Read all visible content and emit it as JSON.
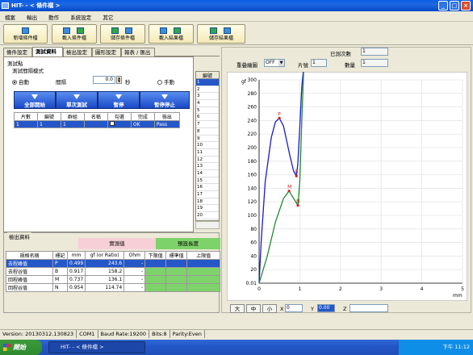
{
  "window": {
    "title": "HIT- - < 條件檔 >",
    "min": "_",
    "max": "□",
    "close": "×"
  },
  "menu": [
    "檔案",
    "輸出",
    "動作",
    "系統設定",
    "其它"
  ],
  "toolbar": [
    {
      "label": "新增條件檔"
    },
    {
      "label": "載入條件檔"
    },
    {
      "label": "儲存條件檔"
    },
    {
      "label": "載入結果檔"
    },
    {
      "label": "儲存結果檔"
    }
  ],
  "tabs": [
    "條件設定",
    "測試資料",
    "檢出設定",
    "圖形設定",
    "報表 / 匯出"
  ],
  "test": {
    "group_title": "測試點",
    "mode_title": "測試間隔模式",
    "auto": "自動",
    "interval": "間隔",
    "interval_value": "0.0",
    "unit": "秒",
    "manual": "手動"
  },
  "buttons": {
    "start": "全部開始",
    "single": "單次測試",
    "pause": "暫停",
    "stop": "暫停停止"
  },
  "table": {
    "headers": [
      "片數",
      "編號",
      "群組",
      "名稱",
      "勾選",
      "完成",
      "檢出"
    ],
    "rows": [
      [
        "1",
        "1",
        "1",
        "",
        "",
        "OK",
        "Pass"
      ]
    ]
  },
  "index_col": {
    "header": "編號",
    "items": [
      "1",
      "2",
      "3",
      "4",
      "5",
      "6",
      "7",
      "8",
      "9",
      "10",
      "11",
      "12",
      "13",
      "14",
      "15",
      "16",
      "17",
      "18",
      "19",
      "20"
    ]
  },
  "detect": {
    "title": "檢出資料",
    "measured": "實測值",
    "preset": "預設長度",
    "headers": [
      "規格名稱",
      "標記",
      "mm",
      "gf (or Ratio)",
      "Ohm",
      "下限值",
      "標準值",
      "上限值"
    ],
    "rows": [
      [
        "去程峰值",
        "P",
        "0.499",
        "243.6",
        "-"
      ],
      [
        "去程谷值",
        "B",
        "0.917",
        "158.2",
        "-"
      ],
      [
        "回程峰值",
        "M",
        "0.737",
        "136.1",
        "-"
      ],
      [
        "回程谷值",
        "N",
        "0.954",
        "114.74",
        "-"
      ]
    ]
  },
  "graph": {
    "done_label": "已測次數",
    "done_value": "1",
    "overlay_label": "重疊繪圖",
    "overlay_value": "OFF",
    "piece_label": "片號",
    "piece_value": "1",
    "count_label": "數量",
    "count_value": "1",
    "zoom": [
      "大",
      "中",
      "小"
    ],
    "x_label": "X",
    "x_value": "0",
    "y_label": "Y",
    "y_value": "0.00",
    "z_label": "Z",
    "z_value": ""
  },
  "chart_data": {
    "type": "line",
    "ylabel": "gf",
    "xlabel": "mm",
    "xlim": [
      0,
      5
    ],
    "ylim": [
      0,
      300
    ],
    "xticks": [
      "0",
      "1",
      "2",
      "3",
      "4",
      "5"
    ],
    "yticks": [
      "0.01",
      "20",
      "40",
      "60",
      "80",
      "100",
      "120",
      "140",
      "160",
      "180",
      "200",
      "220",
      "240",
      "260",
      "280",
      "300"
    ],
    "series": [
      {
        "color": "#1a1ad0",
        "x": [
          0,
          0.05,
          0.15,
          0.3,
          0.4,
          0.499,
          0.6,
          0.75,
          0.85,
          0.917,
          0.95,
          1.0,
          1.05,
          1.1
        ],
        "y": [
          0,
          60,
          150,
          215,
          238,
          243.6,
          232,
          190,
          165,
          158.2,
          175,
          230,
          290,
          320
        ]
      },
      {
        "color": "#208a30",
        "x": [
          0,
          0.2,
          0.4,
          0.6,
          0.737,
          0.85,
          0.954,
          1.0,
          1.05,
          1.1
        ],
        "y": [
          0,
          40,
          90,
          125,
          136.1,
          125,
          114.74,
          150,
          240,
          320
        ]
      }
    ],
    "markers": [
      {
        "label": "P",
        "x": 0.499,
        "y": 243.6
      },
      {
        "label": "B",
        "x": 0.917,
        "y": 158.2
      },
      {
        "label": "M",
        "x": 0.737,
        "y": 136.1
      },
      {
        "label": "N",
        "x": 0.954,
        "y": 114.74
      }
    ],
    "grid": true
  },
  "status": [
    "Version: 20130312.130823",
    "COM1",
    "Baud Rate:19200",
    "Bits:8",
    "Parity:Even"
  ],
  "taskbar": {
    "start": "開始",
    "item": "HIT- - < 條件檔 >",
    "time": "下午 11:12"
  },
  "colors": {
    "selected_row": "#2557c9",
    "measured_header": "#f6d0d6",
    "preset_header": "#7ed26a",
    "chart_bg": "#ffffff"
  }
}
